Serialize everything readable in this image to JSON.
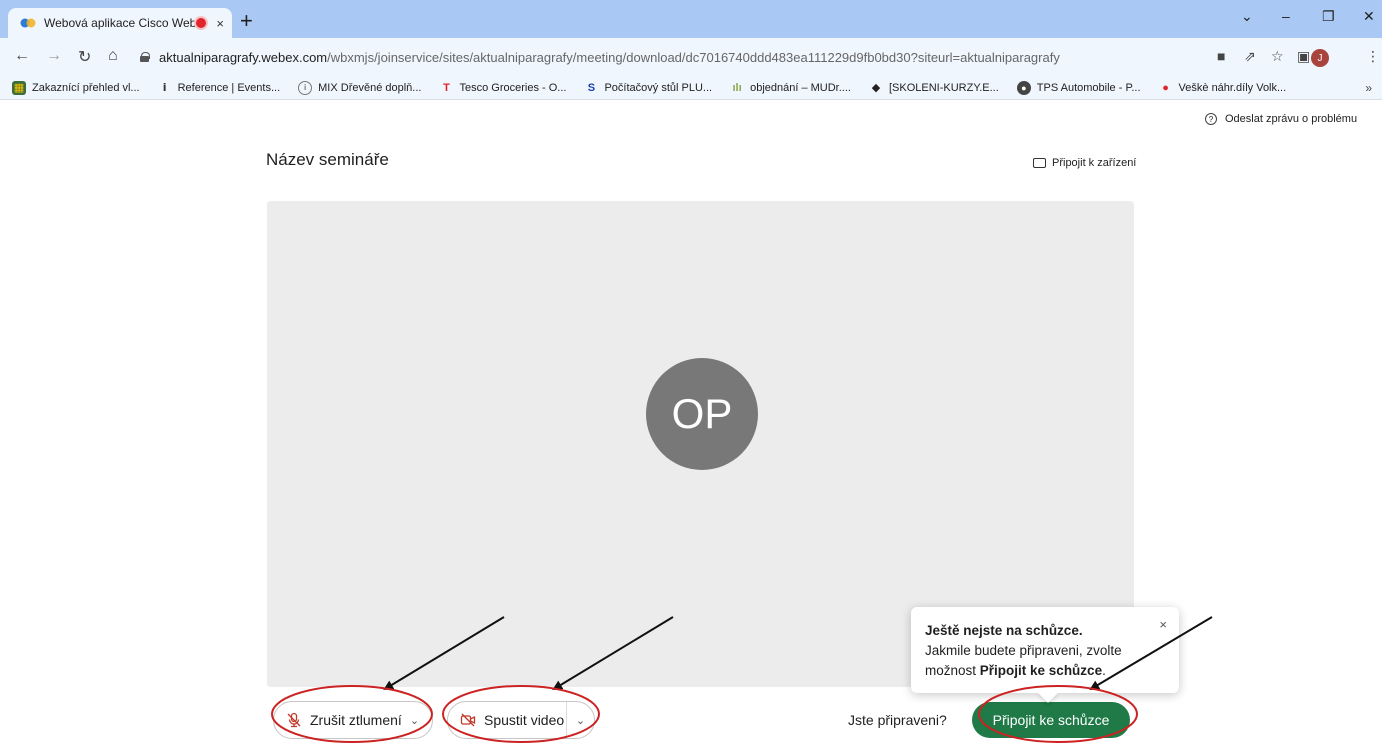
{
  "browser": {
    "tab_title": "Webová aplikace Cisco Webe",
    "new_tab": "+",
    "tab_close": "×",
    "url_host": "aktualniparagrafy.webex.com",
    "url_path": "/wbxmjs/joinservice/sites/aktualniparagrafy/meeting/download/dc7016740ddd483ea111229d9fb0bd30?siteurl=aktualniparagrafy",
    "profile_initial": "J",
    "bookmarks": [
      {
        "label": "Zakaznící přehled vl...",
        "icon": "grid-app-icon"
      },
      {
        "label": "Reference | Events...",
        "icon": "info-icon"
      },
      {
        "label": "MIX Dřevěné doplň...",
        "icon": "shield-icon"
      },
      {
        "label": "Tesco Groceries - O...",
        "icon": "tesco-icon"
      },
      {
        "label": "Počítačový stůl PLU...",
        "icon": "s-icon"
      },
      {
        "label": "objednání – MUDr....",
        "icon": "chart-icon"
      },
      {
        "label": "[SKOLENI-KURZY.E...",
        "icon": "graduation-cap-icon"
      },
      {
        "label": "TPS Automobile - P...",
        "icon": "globe-icon"
      },
      {
        "label": "Veškè náhr.díly Volk...",
        "icon": "circle-icon"
      }
    ],
    "bookmarks_more": "»"
  },
  "page": {
    "report_problem": "Odeslat zprávu o problému",
    "title": "Název semináře",
    "connect_device": "Připojit k zařízení",
    "avatar_initials": "OP",
    "mute_label": "Zrušit ztlumení",
    "video_label": "Spustit video",
    "ready_text": "Jste připraveni?",
    "join_label": "Připojit ke schůzce"
  },
  "tooltip": {
    "heading": "Ještě nejste na schůzce.",
    "line2": "Jakmile budete připraveni, zvolte",
    "line3_prefix": "možnost ",
    "line3_bold": "Připojit ke schůzce",
    "line3_suffix": ".",
    "close": "×"
  },
  "colors": {
    "join_button": "#1f7a47",
    "annotation_circle": "#cc2222",
    "tab_strip": "#a9c8f4",
    "avatar_bg": "#787878"
  }
}
